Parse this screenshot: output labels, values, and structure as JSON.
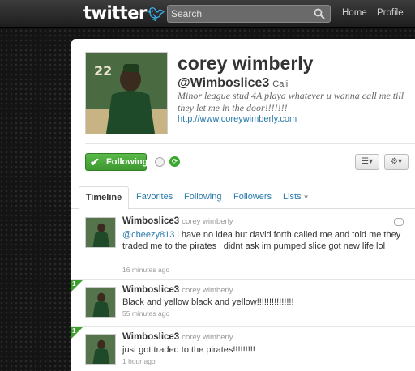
{
  "header": {
    "logo": "twitter",
    "search_placeholder": "Search",
    "nav": {
      "home": "Home",
      "profile": "Profile"
    }
  },
  "profile": {
    "name": "corey wimberly",
    "screen_name": "@Wimboslice3",
    "location": "Cali",
    "bio": "Minor league stud 4A playa whatever u wanna call me till they let me in the door!!!!!!!",
    "url": "http://www.coreywimberly.com",
    "jersey_number": "22",
    "follow_label": "Following"
  },
  "tabs": [
    {
      "label": "Timeline",
      "active": true
    },
    {
      "label": "Favorites"
    },
    {
      "label": "Following"
    },
    {
      "label": "Followers"
    },
    {
      "label": "Lists"
    }
  ],
  "tweets": [
    {
      "user": "Wimboslice3",
      "fullname": "corey wimberly",
      "mention": "@cbeezy813",
      "text": " i have no idea but david forth called me and told me they traded me to the pirates i didnt ask im pumped slice got new life lol",
      "time": "16 minutes ago"
    },
    {
      "user": "Wimboslice3",
      "fullname": "corey wimberly",
      "text": "Black and yellow black and yellow!!!!!!!!!!!!!!!",
      "time": "55 minutes ago",
      "ribbon": "1"
    },
    {
      "user": "Wimboslice3",
      "fullname": "corey wimberly",
      "text": "just got traded to the pirates!!!!!!!!!",
      "time": "1 hour ago",
      "ribbon": "1"
    }
  ],
  "colors": {
    "link": "#2a7aaa",
    "follow_green": "#3d9930",
    "top_bar": "#2b2b2b"
  }
}
